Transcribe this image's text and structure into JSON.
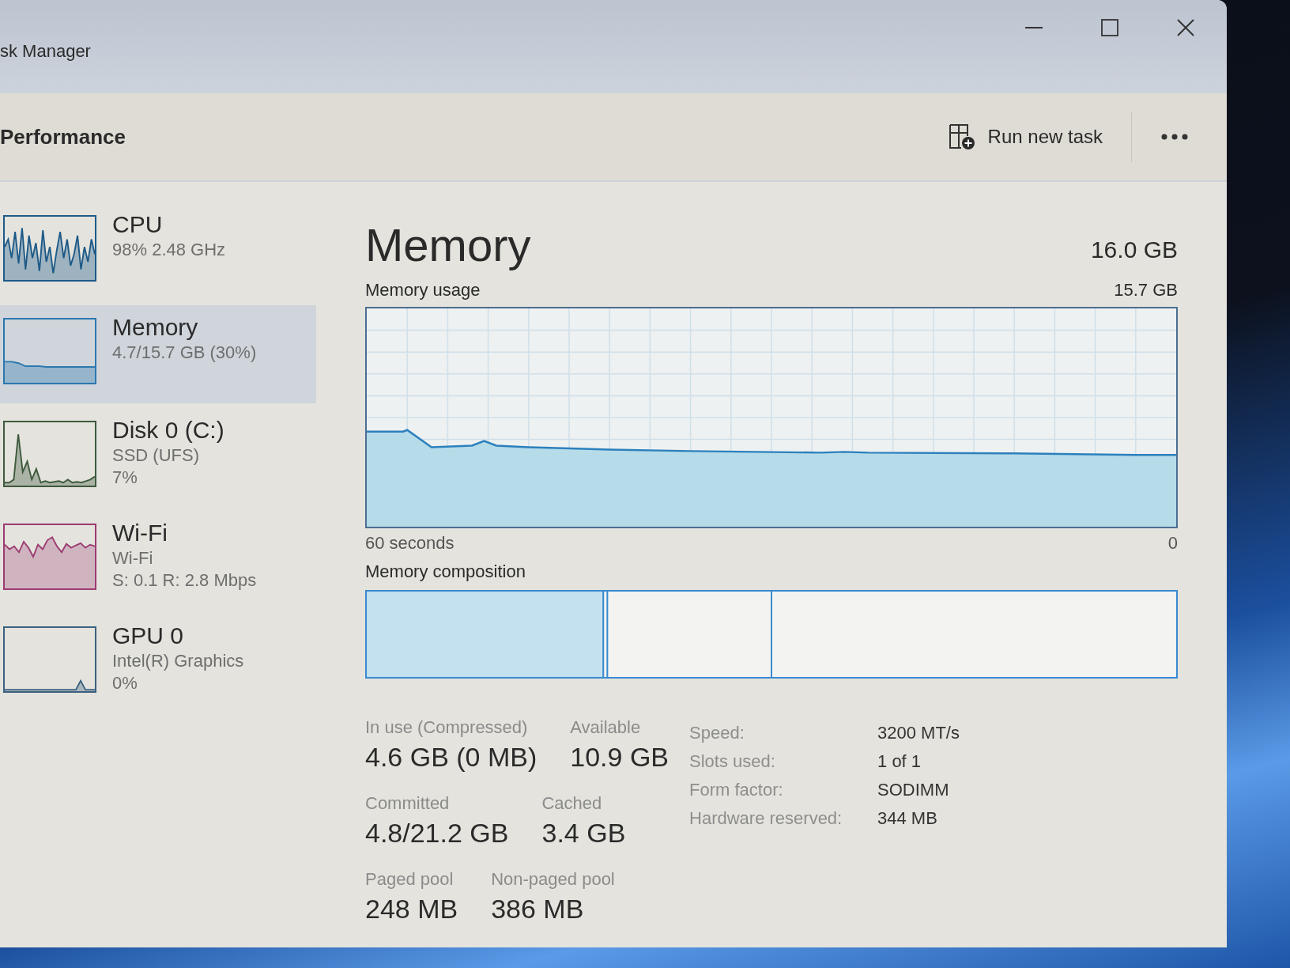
{
  "window": {
    "title": "sk Manager"
  },
  "toolbar": {
    "title": "Performance",
    "run_new_task": "Run new task"
  },
  "sidebar": {
    "items": [
      {
        "kind": "cpu",
        "title": "CPU",
        "details": [
          "98% 2.48 GHz"
        ],
        "color": "#1d5a88",
        "selected": false
      },
      {
        "kind": "memory",
        "title": "Memory",
        "details": [
          "4.7/15.7 GB (30%)"
        ],
        "color": "#2b78b0",
        "selected": true
      },
      {
        "kind": "disk",
        "title": "Disk 0 (C:)",
        "details": [
          "SSD (UFS)",
          "7%"
        ],
        "color": "#3e5a3c",
        "selected": false
      },
      {
        "kind": "network",
        "title": "Wi-Fi",
        "details": [
          "Wi-Fi",
          "S: 0.1 R: 2.8 Mbps"
        ],
        "color": "#9c3b72",
        "selected": false
      },
      {
        "kind": "gpu",
        "title": "GPU 0",
        "details": [
          "Intel(R) Graphics",
          "0%"
        ],
        "color": "#3c6080",
        "selected": false
      }
    ]
  },
  "detail": {
    "title": "Memory",
    "capacity": "16.0 GB",
    "usage_label": "Memory usage",
    "usage_max": "15.7 GB",
    "time_span": "60 seconds",
    "time_end": "0",
    "composition_label": "Memory composition",
    "stat_rows": [
      [
        {
          "label": "In use (Compressed)",
          "value": "4.6 GB (0 MB)"
        },
        {
          "label": "Available",
          "value": "10.9 GB"
        }
      ],
      [
        {
          "label": "Committed",
          "value": "4.8/21.2 GB"
        },
        {
          "label": "Cached",
          "value": "3.4 GB"
        }
      ],
      [
        {
          "label": "Paged pool",
          "value": "248 MB"
        },
        {
          "label": "Non-paged pool",
          "value": "386 MB"
        }
      ]
    ],
    "properties": [
      {
        "label": "Speed:",
        "value": "3200 MT/s"
      },
      {
        "label": "Slots used:",
        "value": "1 of 1"
      },
      {
        "label": "Form factor:",
        "value": "SODIMM"
      },
      {
        "label": "Hardware reserved:",
        "value": "344 MB"
      }
    ]
  }
}
